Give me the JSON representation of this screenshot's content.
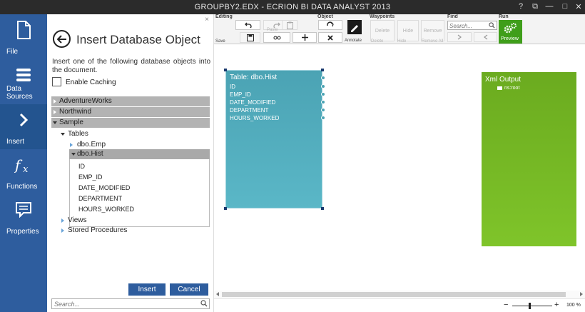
{
  "window": {
    "title": "GROUPBY2.EDX - ECRION BI DATA ANALYST 2013",
    "controls": [
      "?",
      "⧉",
      "—",
      "□",
      "✕"
    ]
  },
  "leftnav": {
    "items": [
      {
        "label": "File",
        "icon": "document-icon"
      },
      {
        "label": "Data Sources",
        "icon": "database-icon"
      },
      {
        "label": "Insert",
        "icon": "chevron-right-icon",
        "active": true
      },
      {
        "label": "Functions",
        "icon": "function-fx-icon"
      },
      {
        "label": "Properties",
        "icon": "speech-bubble-icon"
      }
    ],
    "active_color": "#23548f",
    "bg_color": "#2e5d9e"
  },
  "panel": {
    "close": "×",
    "title": "Insert Database Object",
    "description": "Insert one of the following database objects into the document.",
    "enable_caching_label": "Enable Caching",
    "enable_caching_checked": false,
    "databases": [
      "AdventureWorks",
      "Northwind",
      "Sample"
    ],
    "tree": {
      "tables_label": "Tables",
      "table1": "dbo.Emp",
      "table2": "dbo.Hist",
      "fields": [
        "ID",
        "EMP_ID",
        "DATE_MODIFIED",
        "DEPARTMENT",
        "HOURS_WORKED"
      ],
      "views_label": "Views",
      "stored_procedures_label": "Stored Procedures"
    },
    "insert_label": "Insert",
    "cancel_label": "Cancel",
    "search_placeholder": "Search..."
  },
  "ribbon": {
    "groups": {
      "editing": "Editing",
      "object": "Object",
      "waypoints": "Waypoints",
      "find": "Find",
      "run": "Run"
    },
    "paste_label": "Paste",
    "save_label": "Save",
    "annotate_label": "Annotate",
    "delete_label": "Delete",
    "hide_label": "Hide",
    "remove_label": "Remove",
    "remove_all_label": "Remove All",
    "find_placeholder": "Search...",
    "preview_label": "Preview"
  },
  "canvas": {
    "table_node": {
      "title": "Table: dbo.Hist",
      "fields": [
        "ID",
        "EMP_ID",
        "DATE_MODIFIED",
        "DEPARTMENT",
        "HOURS_WORKED"
      ],
      "color": "#4ba3b4"
    },
    "xml_node": {
      "title": "Xml Output",
      "root": "ns:root",
      "color": "#7fc42a"
    }
  },
  "status": {
    "zoom_minus": "−",
    "zoom_plus": "+",
    "zoom_level": "100 %"
  }
}
